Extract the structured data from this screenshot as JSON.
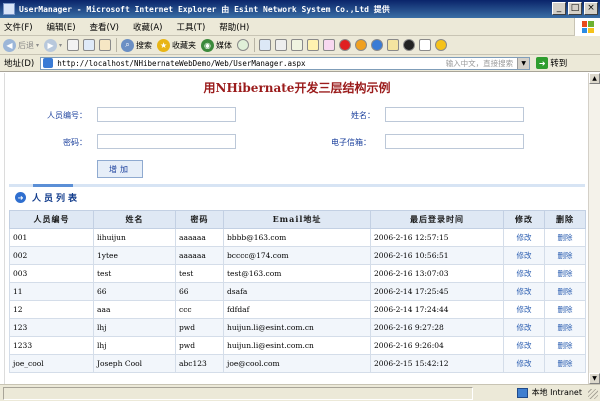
{
  "window": {
    "title": "UserManager - Microsoft Internet Explorer 由 Esint Network System Co.,Ltd 提供",
    "min_glyph": "_",
    "max_glyph": "□",
    "close_glyph": "×"
  },
  "menubar": [
    "文件(F)",
    "编辑(E)",
    "查看(V)",
    "收藏(A)",
    "工具(T)",
    "帮助(H)"
  ],
  "toolbar": {
    "back_label": "后退",
    "search_label": "搜索",
    "favorites_label": "收藏夹",
    "media_label": "媒体"
  },
  "address": {
    "label": "地址(D)",
    "url": "http://localhost/NHibernateWebDemo/Web/UserManager.aspx",
    "hint": "输入中文，直接搜索",
    "go_label": "转到"
  },
  "page": {
    "title": "用NHibernate开发三层结构示例",
    "labels": {
      "id": "人员编号：",
      "name": "姓名：",
      "password": "密码：",
      "email": "电子信箱："
    },
    "add_button": "增加",
    "section_title": "人员列表"
  },
  "table": {
    "headers": [
      "人员编号",
      "姓名",
      "密码",
      "Email地址",
      "最后登录时间",
      "修改",
      "删除"
    ],
    "rows": [
      [
        "001",
        "lihuijun",
        "aaaaaa",
        "bbbb@163.com",
        "2006-2-16 12:57:15",
        "修改",
        "删除"
      ],
      [
        "002",
        "1ytee",
        "aaaaaa",
        "bcccc@174.com",
        "2006-2-16 10:56:51",
        "修改",
        "删除"
      ],
      [
        "003",
        "test",
        "test",
        "test@163.com",
        "2006-2-16 13:07:03",
        "修改",
        "删除"
      ],
      [
        "11",
        "66",
        "66",
        "dsafa",
        "2006-2-14 17:25:45",
        "修改",
        "删除"
      ],
      [
        "12",
        "aaa",
        "ccc",
        "fdfdaf",
        "2006-2-14 17:24:44",
        "修改",
        "删除"
      ],
      [
        "123",
        "lhj",
        "pwd",
        "huijun.li@esint.com.cn",
        "2006-2-16 9:27:28",
        "修改",
        "删除"
      ],
      [
        "1233",
        "lhj",
        "pwd",
        "huijun.li@esint.com.cn",
        "2006-2-16 9:26:04",
        "修改",
        "删除"
      ],
      [
        "joe_cool",
        "Joseph Cool",
        "abc123",
        "joe@cool.com",
        "2006-2-15 15:42:12",
        "修改",
        "删除"
      ]
    ]
  },
  "status": {
    "zone": "本地 Intranet"
  }
}
